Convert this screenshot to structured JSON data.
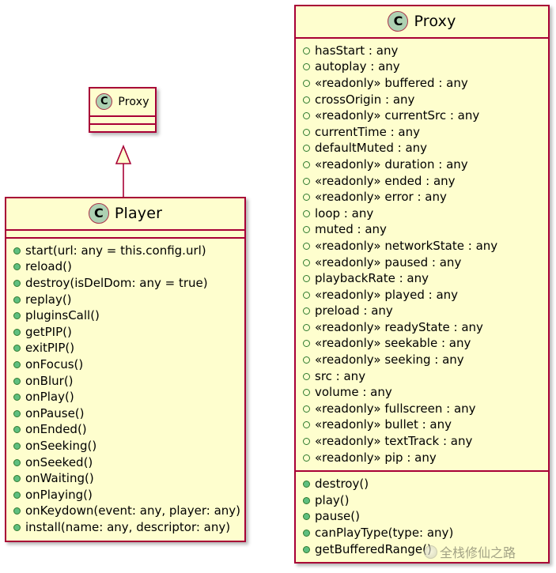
{
  "diagram": {
    "kind": "uml-class-diagram",
    "colors": {
      "border": "#A80036",
      "fill": "#FEFECE",
      "class_icon_fill": "#ADD1B2",
      "class_icon_border": "#A9324A",
      "attribute_marker": "#2F7A2F",
      "method_marker": "#5FBF7F",
      "text": "#000000"
    },
    "relationship": {
      "type": "inheritance",
      "arrow": "hollow-triangle",
      "from": "Player",
      "to": "Proxy"
    }
  },
  "class_icon_letter": "C",
  "proxy_base": {
    "name": "Proxy",
    "attributes": [],
    "methods": []
  },
  "player": {
    "name": "Player",
    "attributes": [],
    "methods": [
      "start(url: any = this.config.url)",
      "reload()",
      "destroy(isDelDom: any = true)",
      "replay()",
      "pluginsCall()",
      "getPIP()",
      "exitPIP()",
      "onFocus()",
      "onBlur()",
      "onPlay()",
      "onPause()",
      "onEnded()",
      "onSeeking()",
      "onSeeked()",
      "onWaiting()",
      "onPlaying()",
      "onKeydown(event: any, player: any)",
      "install(name: any, descriptor: any)"
    ]
  },
  "proxy": {
    "name": "Proxy",
    "attributes": [
      "hasStart : any",
      "autoplay : any",
      "«readonly» buffered : any",
      "crossOrigin : any",
      "«readonly» currentSrc : any",
      "currentTime : any",
      "defaultMuted : any",
      "«readonly» duration : any",
      "«readonly» ended : any",
      "«readonly» error : any",
      "loop : any",
      "muted : any",
      "«readonly» networkState : any",
      "«readonly» paused : any",
      "playbackRate : any",
      "«readonly» played : any",
      "preload : any",
      "«readonly» readyState : any",
      "«readonly» seekable : any",
      "«readonly» seeking : any",
      "src : any",
      "volume : any",
      "«readonly» fullscreen : any",
      "«readonly» bullet : any",
      "«readonly» textTrack : any",
      "«readonly» pip : any"
    ],
    "methods": [
      "destroy()",
      "play()",
      "pause()",
      "canPlayType(type: any)",
      "getBufferedRange()"
    ]
  },
  "watermark": {
    "text": "全栈修仙之路",
    "logo": "circle-logo-icon"
  }
}
